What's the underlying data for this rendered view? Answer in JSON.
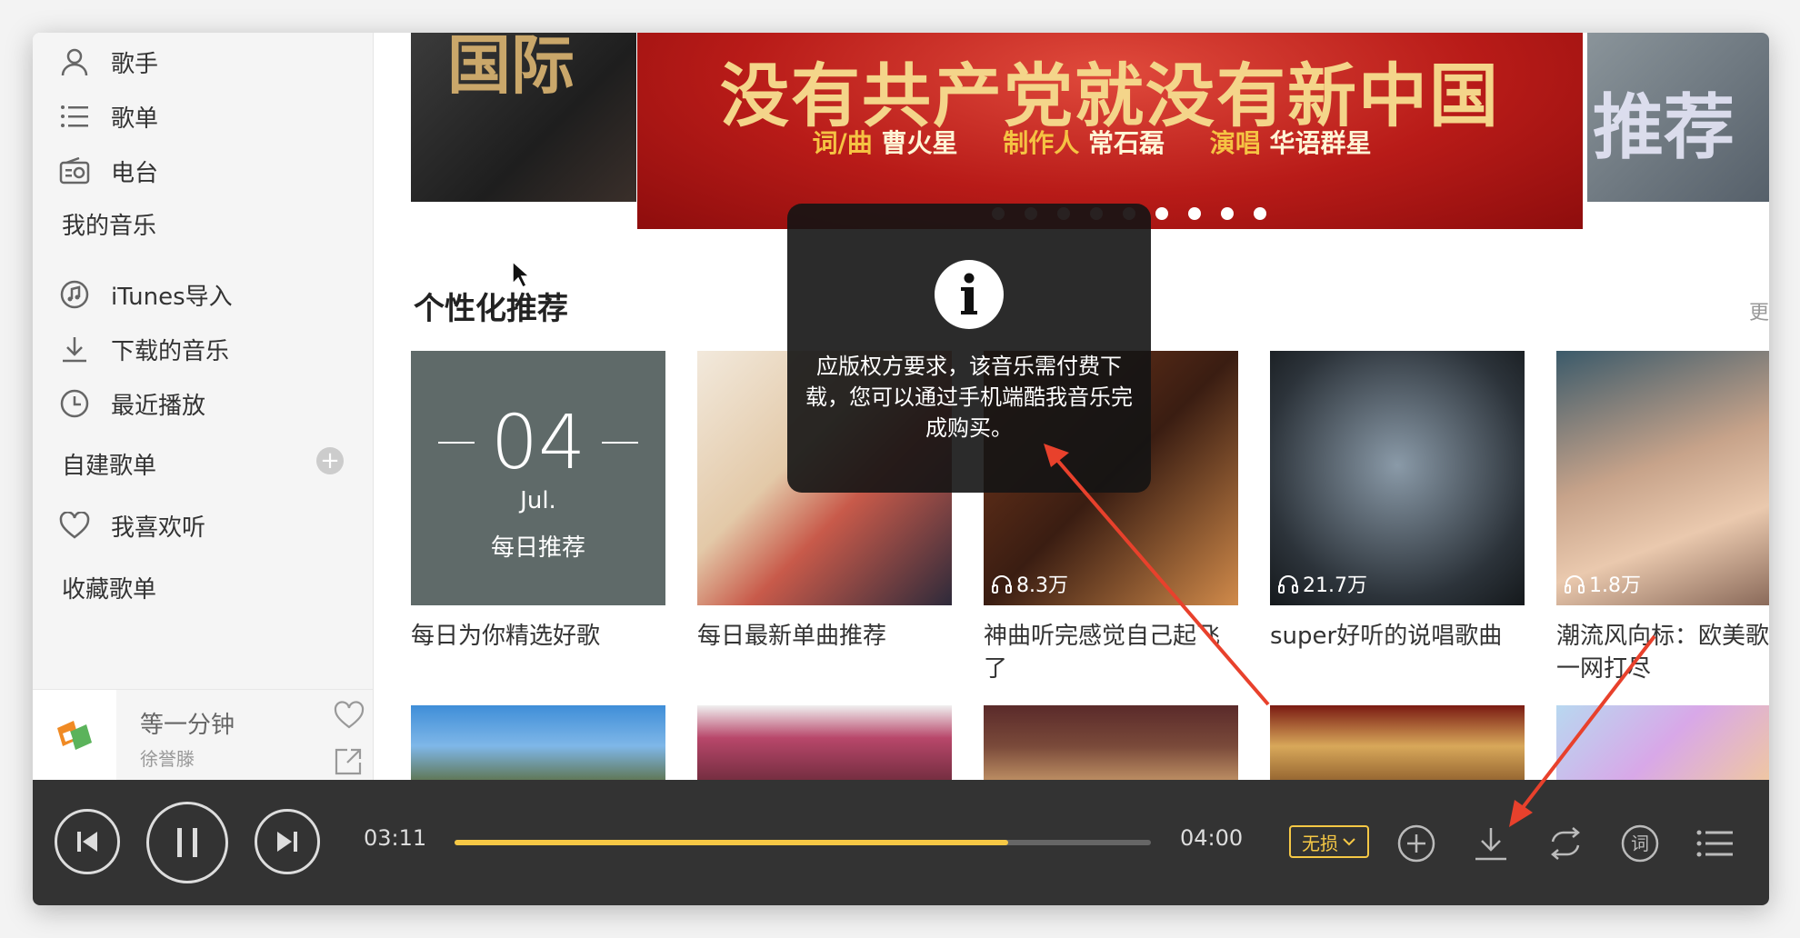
{
  "sidebar": {
    "nav": [
      {
        "label": "歌手",
        "icon": "user-icon"
      },
      {
        "label": "歌单",
        "icon": "list-icon"
      },
      {
        "label": "电台",
        "icon": "radio-icon"
      }
    ],
    "my_music_title": "我的音乐",
    "my_music": [
      {
        "label": "iTunes导入",
        "icon": "music-note-icon"
      },
      {
        "label": "下载的音乐",
        "icon": "download-icon"
      },
      {
        "label": "最近播放",
        "icon": "clock-icon"
      }
    ],
    "playlists_title": "自建歌单",
    "add_label": "+",
    "liked_label": "我喜欢听",
    "collected_title": "收藏歌单"
  },
  "mini_player": {
    "title": "等一分钟",
    "artist": "徐誉滕"
  },
  "banner": {
    "headline": "没有共产党就没有新中国",
    "credits": [
      {
        "key": "词/曲",
        "value": "曹火星"
      },
      {
        "key": "制作人",
        "value": "常石磊"
      },
      {
        "key": "演唱",
        "value": "华语群星"
      }
    ],
    "left_text": "国际",
    "right_text": "推荐",
    "dot_count": 9,
    "active_dots": [
      5,
      6,
      7,
      8
    ]
  },
  "recommend": {
    "heading": "个性化推荐",
    "more": "更",
    "cards": [
      {
        "title": "每日为你精选好歌",
        "type": "daily",
        "day": "04",
        "month": "Jul.",
        "daily_title": "每日推荐"
      },
      {
        "title": "每日最新单曲推荐",
        "type": "cover",
        "plays": ""
      },
      {
        "title": "神曲听完感觉自己起飞了",
        "type": "cover",
        "plays": "8.3万"
      },
      {
        "title": "super好听的说唱歌曲",
        "type": "cover",
        "plays": "21.7万"
      },
      {
        "title": "潮流风向标：欧美歌一网打尽",
        "type": "cover",
        "plays": "1.8万"
      }
    ]
  },
  "toast": {
    "message": "应版权方要求，该音乐需付费下载，您可以通过手机端酷我音乐完成购买。"
  },
  "player": {
    "current_time": "03:11",
    "total_time": "04:00",
    "progress": 0.795,
    "quality_label": "无损"
  },
  "colors": {
    "accent": "#f6c845",
    "player_bg": "#333333",
    "arrow": "#e8412c"
  }
}
